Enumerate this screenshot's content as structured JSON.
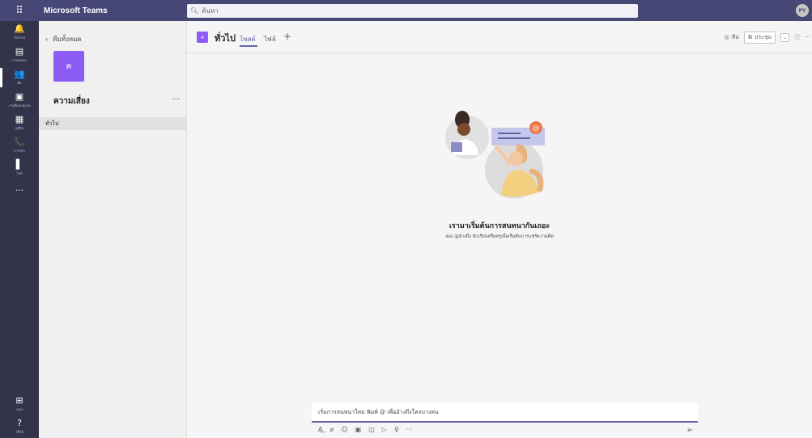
{
  "topbar": {
    "app_title": "Microsoft Teams",
    "search_placeholder": "ค้นหา",
    "avatar_initials": "PY"
  },
  "rail": {
    "items": [
      {
        "icon": "bell-icon",
        "glyph": "🔔",
        "label": "กิจกรรม",
        "active": false
      },
      {
        "icon": "chat-icon",
        "glyph": "▤",
        "label": "การสนทนา",
        "active": false
      },
      {
        "icon": "teams-icon",
        "glyph": "👥",
        "label": "ทีม",
        "active": true
      },
      {
        "icon": "assignments-icon",
        "glyph": "▣",
        "label": "งานที่มอบหมาย",
        "active": false
      },
      {
        "icon": "calendar-icon",
        "glyph": "▦",
        "label": "ปฏิทิน",
        "active": false
      },
      {
        "icon": "calls-icon",
        "glyph": "📞",
        "label": "การโทร",
        "active": false
      },
      {
        "icon": "files-icon",
        "glyph": "▌",
        "label": "ไฟล์",
        "active": false
      },
      {
        "icon": "more-apps-icon",
        "glyph": "···",
        "label": "",
        "active": false
      }
    ],
    "bottom": [
      {
        "icon": "apps-icon",
        "glyph": "⊞",
        "label": "แอป"
      },
      {
        "icon": "help-icon",
        "glyph": "?",
        "label": "วิธีใช้"
      }
    ]
  },
  "panel": {
    "back_label": "ทีมทั้งหมด",
    "team_initial": "ค",
    "team_name": "ความเสี่ยง",
    "more": "···",
    "channels": [
      "ทั่วไป"
    ]
  },
  "header": {
    "channel_tile": "ค",
    "channel_name": "ทั่วไป",
    "tabs": [
      {
        "label": "โพสต์",
        "active": true
      },
      {
        "label": "ไฟล์",
        "active": false
      }
    ],
    "add_tab": "+",
    "team_label": "ทีม",
    "meet_label": "ประชุม",
    "info": "ⓘ",
    "more": "···"
  },
  "empty_state": {
    "title": "เรามาเริ่มต้นการสนทนากันเถอะ",
    "subtitle": "ลอง @อ้างถึง นักเรียนหรือครูเพื่อเริ่มต้นการแชร์ความคิด"
  },
  "compose": {
    "placeholder": "เริ่มการสนทนาใหม่ พิมพ์ @ เพื่ออ้างถึงใครบางคน",
    "tools": [
      "format-icon",
      "attach-icon",
      "emoji-icon",
      "gif-icon",
      "sticker-icon",
      "meet-now-icon",
      "praise-icon",
      "more-icon"
    ],
    "tool_glyphs": [
      "A͟",
      "⌀",
      "☺",
      "▣",
      "◫",
      "▷",
      "♀",
      "···"
    ]
  },
  "colors": {
    "topbar": "#464775",
    "rail": "#33344a",
    "accent": "#6264a7",
    "team_tile": "#8b5cf6"
  }
}
